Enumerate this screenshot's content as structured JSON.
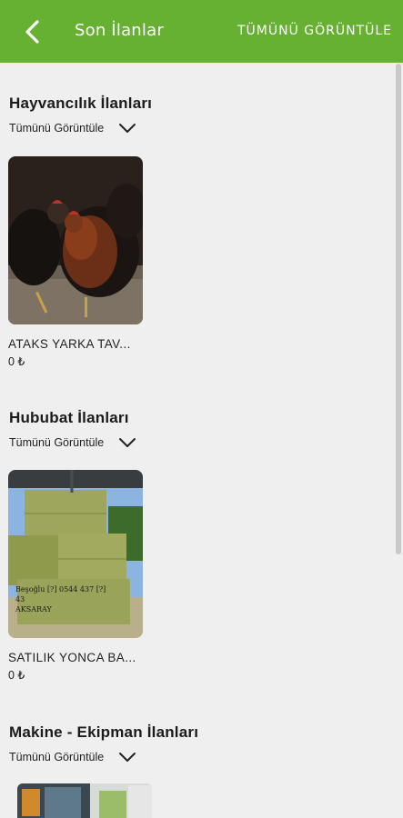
{
  "header": {
    "title": "Son İlanlar",
    "view_all": "TÜMÜNÜ GÖRÜNTÜLE",
    "bg_color": "#66b032"
  },
  "sections": [
    {
      "title": "Hayvancılık İlanları",
      "view_all": "Tümünü Görüntüle",
      "items": [
        {
          "title": "ATAKS YARKA TAV...",
          "price": "0 ₺",
          "image": "chickens-photo"
        }
      ]
    },
    {
      "title": "Hububat İlanları",
      "view_all": "Tümünü Görüntüle",
      "items": [
        {
          "title": "SATILIK YONCA BA...",
          "price": "0 ₺",
          "image": "hay-bales-photo",
          "image_text": [
            "Beşoğlu [?] 0544 437 [?]",
            "43",
            "AKSARAY"
          ]
        }
      ]
    },
    {
      "title": "Makine - Ekipman İlanları",
      "view_all": "Tümünü Görüntüle",
      "items": [
        {
          "image": "machinery-photo"
        }
      ]
    }
  ]
}
